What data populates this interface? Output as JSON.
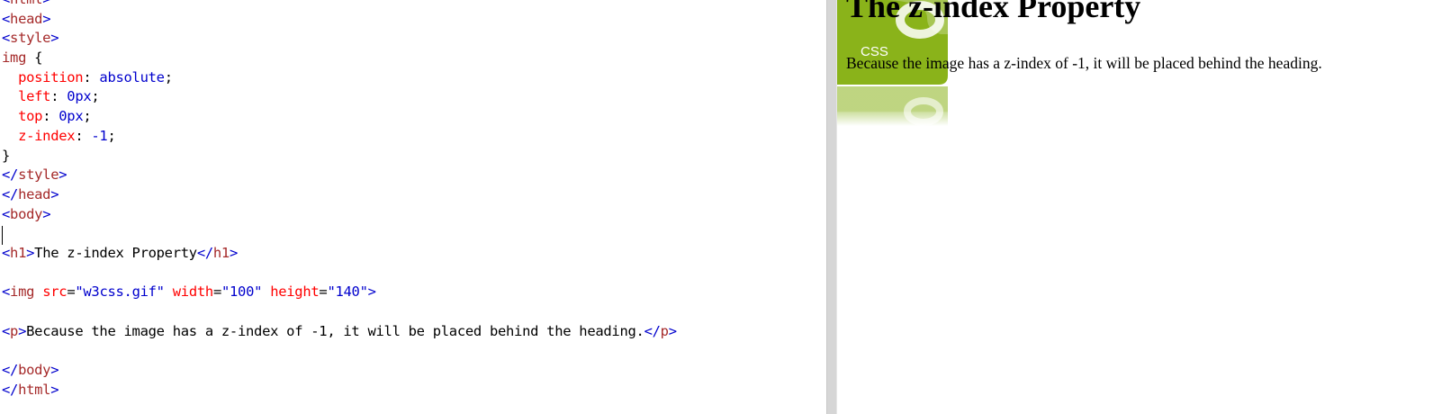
{
  "editor": {
    "lines": [
      {
        "parts": [
          {
            "c": "br",
            "t": "<"
          },
          {
            "c": "tag",
            "t": "html"
          },
          {
            "c": "br",
            "t": ">"
          }
        ]
      },
      {
        "parts": [
          {
            "c": "br",
            "t": "<"
          },
          {
            "c": "tag",
            "t": "head"
          },
          {
            "c": "br",
            "t": ">"
          }
        ]
      },
      {
        "parts": [
          {
            "c": "br",
            "t": "<"
          },
          {
            "c": "tag",
            "t": "style"
          },
          {
            "c": "br",
            "t": ">"
          }
        ]
      },
      {
        "parts": [
          {
            "c": "tag",
            "t": "img"
          },
          {
            "c": "txt",
            "t": " {"
          }
        ]
      },
      {
        "parts": [
          {
            "c": "txt",
            "t": "  "
          },
          {
            "c": "prop",
            "t": "position"
          },
          {
            "c": "txt",
            "t": ": "
          },
          {
            "c": "val",
            "t": "absolute"
          },
          {
            "c": "txt",
            "t": ";"
          }
        ]
      },
      {
        "parts": [
          {
            "c": "txt",
            "t": "  "
          },
          {
            "c": "prop",
            "t": "left"
          },
          {
            "c": "txt",
            "t": ": "
          },
          {
            "c": "val",
            "t": "0px"
          },
          {
            "c": "txt",
            "t": ";"
          }
        ]
      },
      {
        "parts": [
          {
            "c": "txt",
            "t": "  "
          },
          {
            "c": "prop",
            "t": "top"
          },
          {
            "c": "txt",
            "t": ": "
          },
          {
            "c": "val",
            "t": "0px"
          },
          {
            "c": "txt",
            "t": ";"
          }
        ]
      },
      {
        "parts": [
          {
            "c": "txt",
            "t": "  "
          },
          {
            "c": "prop",
            "t": "z-index"
          },
          {
            "c": "txt",
            "t": ": "
          },
          {
            "c": "val",
            "t": "-1"
          },
          {
            "c": "txt",
            "t": ";"
          }
        ]
      },
      {
        "parts": [
          {
            "c": "txt",
            "t": "}"
          }
        ]
      },
      {
        "parts": [
          {
            "c": "br",
            "t": "</"
          },
          {
            "c": "tag",
            "t": "style"
          },
          {
            "c": "br",
            "t": ">"
          }
        ]
      },
      {
        "parts": [
          {
            "c": "br",
            "t": "</"
          },
          {
            "c": "tag",
            "t": "head"
          },
          {
            "c": "br",
            "t": ">"
          }
        ]
      },
      {
        "parts": [
          {
            "c": "br",
            "t": "<"
          },
          {
            "c": "tag",
            "t": "body"
          },
          {
            "c": "br",
            "t": ">"
          }
        ]
      },
      {
        "parts": []
      },
      {
        "parts": [
          {
            "c": "br",
            "t": "<"
          },
          {
            "c": "tag",
            "t": "h1"
          },
          {
            "c": "br",
            "t": ">"
          },
          {
            "c": "txt",
            "t": "The z-index Property"
          },
          {
            "c": "br",
            "t": "</"
          },
          {
            "c": "tag",
            "t": "h1"
          },
          {
            "c": "br",
            "t": ">"
          }
        ]
      },
      {
        "parts": []
      },
      {
        "parts": [
          {
            "c": "br",
            "t": "<"
          },
          {
            "c": "tag",
            "t": "img"
          },
          {
            "c": "txt",
            "t": " "
          },
          {
            "c": "attr",
            "t": "src"
          },
          {
            "c": "txt",
            "t": "="
          },
          {
            "c": "val",
            "t": "\"w3css.gif\""
          },
          {
            "c": "txt",
            "t": " "
          },
          {
            "c": "attr",
            "t": "width"
          },
          {
            "c": "txt",
            "t": "="
          },
          {
            "c": "val",
            "t": "\"100\""
          },
          {
            "c": "txt",
            "t": " "
          },
          {
            "c": "attr",
            "t": "height"
          },
          {
            "c": "txt",
            "t": "="
          },
          {
            "c": "val",
            "t": "\"140\""
          },
          {
            "c": "br",
            "t": ">"
          }
        ]
      },
      {
        "parts": []
      },
      {
        "parts": [
          {
            "c": "br",
            "t": "<"
          },
          {
            "c": "tag",
            "t": "p"
          },
          {
            "c": "br",
            "t": ">"
          },
          {
            "c": "txt",
            "t": "Because the image has a z-index of -1, it will be placed behind the heading."
          },
          {
            "c": "br",
            "t": "</"
          },
          {
            "c": "tag",
            "t": "p"
          },
          {
            "c": "br",
            "t": ">"
          }
        ]
      },
      {
        "parts": []
      },
      {
        "parts": [
          {
            "c": "br",
            "t": "</"
          },
          {
            "c": "tag",
            "t": "body"
          },
          {
            "c": "br",
            "t": ">"
          }
        ]
      },
      {
        "parts": [
          {
            "c": "br",
            "t": "</"
          },
          {
            "c": "tag",
            "t": "html"
          },
          {
            "c": "br",
            "t": ">"
          }
        ]
      }
    ]
  },
  "preview": {
    "heading": "The z-index Property",
    "paragraph": "Because the image has a z-index of -1, it will be placed behind the heading.",
    "logo_text": "CSS",
    "logo_color": "#8ab31a"
  }
}
